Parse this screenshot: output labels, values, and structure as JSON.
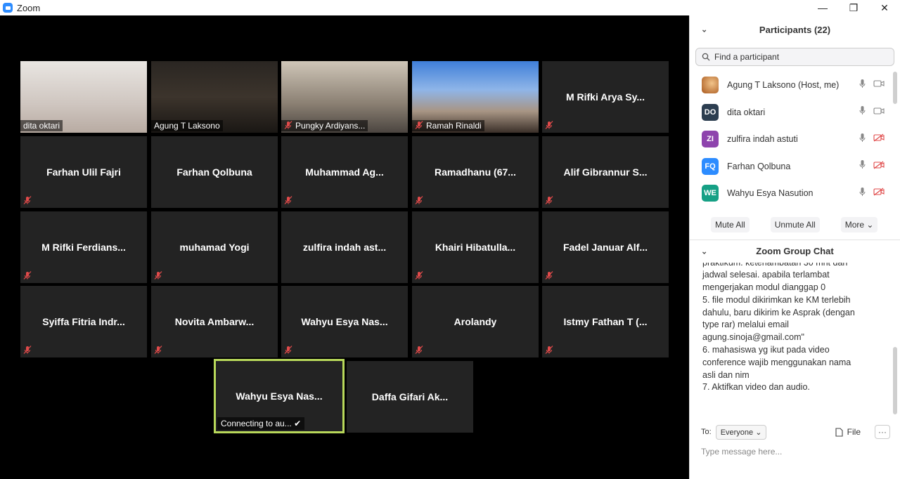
{
  "window": {
    "title": "Zoom",
    "minimize": "—",
    "restore": "❐",
    "close": "✕"
  },
  "tiles": [
    {
      "name": "dita oktari",
      "video": true,
      "muted": false
    },
    {
      "name": "Agung T Laksono",
      "video": true,
      "muted": false
    },
    {
      "name": "Pungky Ardiyans...",
      "video": true,
      "muted": true
    },
    {
      "name": "Ramah Rinaldi",
      "video": true,
      "muted": true
    },
    {
      "name": "M Rifki Arya Sy...",
      "video": false,
      "muted": true
    },
    {
      "name": "Farhan Ulil Fajri",
      "video": false,
      "muted": true
    },
    {
      "name": "Farhan Qolbuna",
      "video": false,
      "muted": false
    },
    {
      "name": "Muhammad Ag...",
      "video": false,
      "muted": true
    },
    {
      "name": "Ramadhanu (67...",
      "video": false,
      "muted": true
    },
    {
      "name": "Alif Gibrannur S...",
      "video": false,
      "muted": true
    },
    {
      "name": "M Rifki Ferdians...",
      "video": false,
      "muted": true
    },
    {
      "name": "muhamad Yogi",
      "video": false,
      "muted": true
    },
    {
      "name": "zulfira indah ast...",
      "video": false,
      "muted": false
    },
    {
      "name": "Khairi Hibatulla...",
      "video": false,
      "muted": true
    },
    {
      "name": "Fadel Januar Alf...",
      "video": false,
      "muted": true
    },
    {
      "name": "Syiffa Fitria Indr...",
      "video": false,
      "muted": true
    },
    {
      "name": "Novita Ambarw...",
      "video": false,
      "muted": true
    },
    {
      "name": "Wahyu Esya Nas...",
      "video": false,
      "muted": true
    },
    {
      "name": "Arolandy",
      "video": false,
      "muted": true
    },
    {
      "name": "Istmy Fathan T (...",
      "video": false,
      "muted": true
    },
    {
      "name": "Wahyu Esya Nas...",
      "video": false,
      "muted": false,
      "status": "Connecting to au... ✔"
    },
    {
      "name": "Daffa Gifari Ak...",
      "video": false,
      "muted": false
    }
  ],
  "participants_panel": {
    "title": "Participants (22)",
    "search_placeholder": "Find a participant",
    "list": [
      {
        "initials": "",
        "name": "Agung T Laksono (Host, me)",
        "color": "#c8742c",
        "video_off": false
      },
      {
        "initials": "DO",
        "name": "dita oktari",
        "color": "#2c3e50",
        "video_off": false
      },
      {
        "initials": "ZI",
        "name": "zulfira indah astuti",
        "color": "#8e44ad",
        "video_off": true
      },
      {
        "initials": "FQ",
        "name": "Farhan Qolbuna",
        "color": "#2d8cff",
        "video_off": true
      },
      {
        "initials": "WE",
        "name": "Wahyu Esya Nasution",
        "color": "#16a085",
        "video_off": true
      }
    ],
    "mute_all": "Mute All",
    "unmute_all": "Unmute All",
    "more": "More ⌄"
  },
  "chat": {
    "title": "Zoom Group Chat",
    "lines": [
      "praktikum. keterlambatan 30 mnt dari",
      "jadwal selesai. apabila terlambat",
      "mengerjakan modul dianggap 0",
      "5. file modul dikirimkan ke KM terlebih",
      "dahulu, baru dikirim ke Asprak (dengan",
      "type rar) melalui email",
      "agung.sinoja@gmail.com\"",
      "6. mahasiswa yg ikut pada video",
      "conference wajib menggunakan nama",
      "asli dan nim",
      "7. Aktifkan video dan audio."
    ],
    "to_label": "To:",
    "to_value": "Everyone ⌄",
    "file_label": "File",
    "more_label": "···",
    "input_placeholder": "Type message here..."
  }
}
